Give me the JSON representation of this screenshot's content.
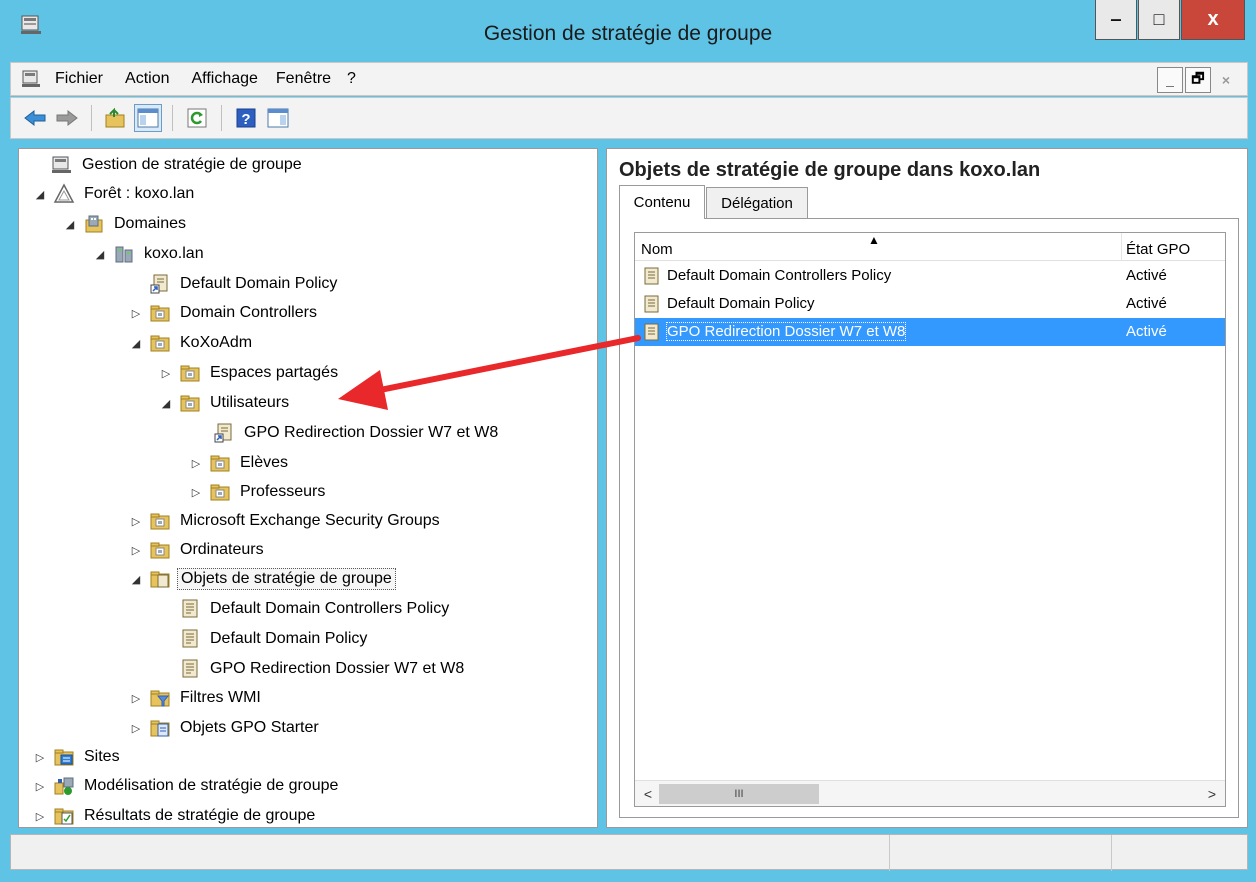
{
  "window": {
    "title": "Gestion de stratégie de groupe",
    "minimize": "‒",
    "maximize": "□",
    "close": "x"
  },
  "menu": {
    "items": [
      "Fichier",
      "Action",
      "Affichage",
      "Fenêtre",
      "?"
    ]
  },
  "tree": {
    "root": "Gestion de stratégie de groupe",
    "forest": "Forêt : koxo.lan",
    "domains": "Domaines",
    "domain": "koxo.lan",
    "ddp": "Default Domain Policy",
    "dc": "Domain Controllers",
    "koxoadm": "KoXoAdm",
    "espaces": "Espaces partagés",
    "utilisateurs": "Utilisateurs",
    "gpo_link": "GPO Redirection Dossier W7 et W8",
    "eleves": "Elèves",
    "profs": "Professeurs",
    "exchange": "Microsoft Exchange Security Groups",
    "ordinateurs": "Ordinateurs",
    "gpo_container": "Objets de stratégie de groupe",
    "gpo1": "Default Domain Controllers Policy",
    "gpo2": "Default Domain Policy",
    "gpo3": "GPO Redirection Dossier W7 et W8",
    "wmi": "Filtres WMI",
    "starter": "Objets GPO Starter",
    "sites": "Sites",
    "modelisation": "Modélisation de stratégie de groupe",
    "resultats": "Résultats de stratégie de groupe"
  },
  "right": {
    "title": "Objets de stratégie de groupe dans koxo.lan",
    "tabs": [
      "Contenu",
      "Délégation"
    ],
    "columns": {
      "name": "Nom",
      "state": "État GPO"
    },
    "rows": [
      {
        "name": "Default Domain Controllers Policy",
        "state": "Activé"
      },
      {
        "name": "Default Domain Policy",
        "state": "Activé"
      },
      {
        "name": "GPO Redirection Dossier W7 et W8",
        "state": "Activé"
      }
    ],
    "scroll_left": "<",
    "scroll_right": ">",
    "scroll_grip": "III"
  },
  "colors": {
    "titlebar": "#5fc3e6",
    "selection": "#3399ff",
    "annotation_arrow": "#e8282a"
  }
}
